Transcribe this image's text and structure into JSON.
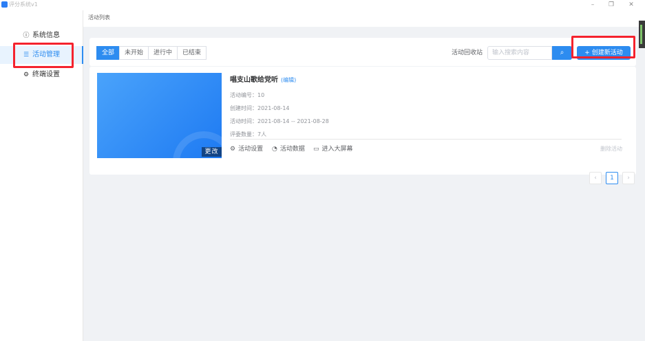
{
  "window": {
    "title": "评分系统v1",
    "controls": {
      "minimize": "–",
      "restore": "❐",
      "close": "✕"
    }
  },
  "sidebar": {
    "items": [
      {
        "label": "系统信息",
        "icon": "info-circle-icon",
        "glyph": "ⓘ",
        "active": false
      },
      {
        "label": "活动管理",
        "icon": "list-icon",
        "glyph": "☰",
        "active": true
      },
      {
        "label": "终端设置",
        "icon": "gear-icon",
        "glyph": "⚙",
        "active": false
      }
    ]
  },
  "breadcrumb": {
    "title": "活动列表"
  },
  "toolbar": {
    "tabs": [
      {
        "label": "全部",
        "active": true
      },
      {
        "label": "未开始",
        "active": false
      },
      {
        "label": "进行中",
        "active": false
      },
      {
        "label": "已结束",
        "active": false
      }
    ],
    "recycle_label": "活动回收站",
    "search_placeholder": "输入搜索内容",
    "search_icon": "⌕",
    "create_label": "+ 创建新活动"
  },
  "activity": {
    "title": "唱支山歌给党听",
    "edit_label": "(编辑)",
    "change_cover_label": "更改",
    "meta": [
      {
        "label": "活动编号：",
        "value": "10"
      },
      {
        "label": "创建时间：",
        "value": "2021-08-14"
      },
      {
        "label": "活动时间：",
        "value": "2021-08-14 -- 2021-08-28"
      },
      {
        "label": "评委数量：",
        "value": "7人"
      }
    ],
    "actions": [
      {
        "label": "活动设置",
        "icon": "gear-icon",
        "glyph": "⚙"
      },
      {
        "label": "活动数据",
        "icon": "pie-chart-icon",
        "glyph": "◔"
      },
      {
        "label": "进入大屏幕",
        "icon": "monitor-icon",
        "glyph": "▭"
      }
    ],
    "delete_label": "删除活动"
  },
  "pagination": {
    "prev": "‹",
    "current": "1",
    "next": "›"
  },
  "colors": {
    "accent": "#2d8cf0",
    "highlight": "#f5222d",
    "background": "#f0f2f5"
  }
}
